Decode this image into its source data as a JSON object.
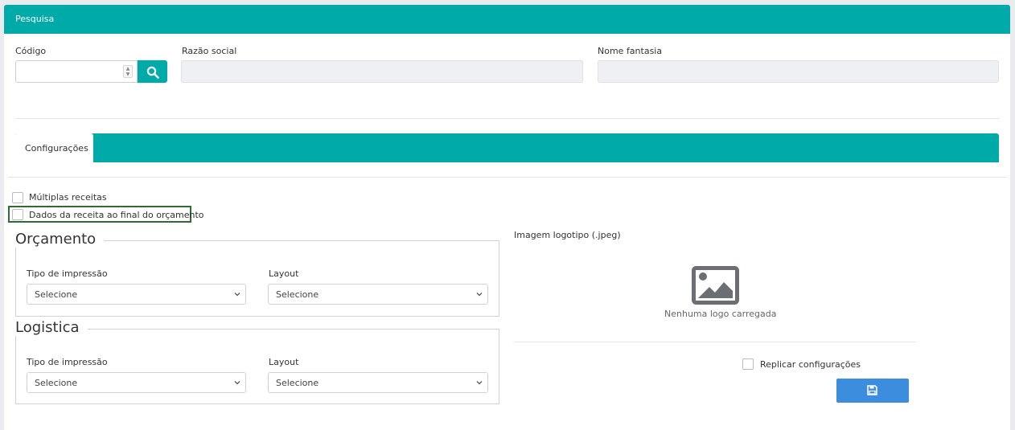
{
  "panel": {
    "title": "Pesquisa"
  },
  "search": {
    "codigo_label": "Código",
    "codigo_value": "",
    "razao_label": "Razão social",
    "razao_value": "",
    "fantasia_label": "Nome fantasia",
    "fantasia_value": ""
  },
  "tabs": [
    {
      "label": "Configurações",
      "active": true
    }
  ],
  "options": {
    "multiplas_receitas": {
      "label": "Múltiplas receitas",
      "checked": false
    },
    "dados_receita": {
      "label": "Dados da receita ao final do orçamento",
      "checked": false
    }
  },
  "orcamento": {
    "legend": "Orçamento",
    "tipo_label": "Tipo de impressão",
    "tipo_value": "Selecione",
    "layout_label": "Layout",
    "layout_value": "Selecione"
  },
  "logistica": {
    "legend": "Logistica",
    "tipo_label": "Tipo de impressão",
    "tipo_value": "Selecione",
    "layout_label": "Layout",
    "layout_value": "Selecione"
  },
  "logo": {
    "label": "Imagem logotipo (.jpeg)",
    "empty_text": "Nenhuma logo carregada",
    "icon": "image-placeholder-icon"
  },
  "replicar": {
    "label": "Replicar configurações",
    "checked": false
  },
  "save": {
    "icon": "floppy-disk-icon"
  },
  "colors": {
    "teal": "#00aaa8",
    "save_blue": "#3c8ddd",
    "highlight": "#2e6b35"
  }
}
